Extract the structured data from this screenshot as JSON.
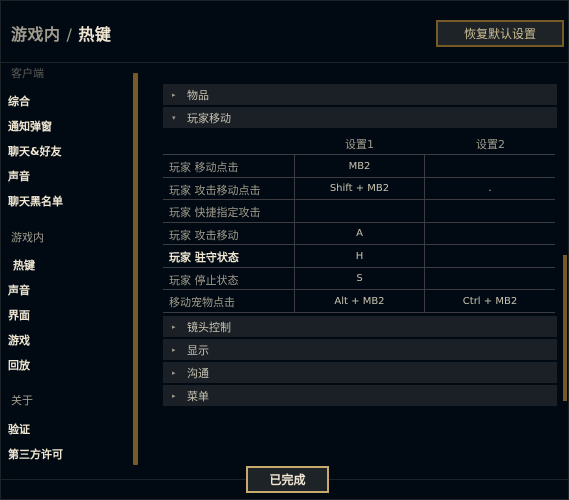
{
  "header": {
    "crumb_parent": "游戏内",
    "separator": "/",
    "crumb_current": "热键",
    "reset_label": "恢复默认设置"
  },
  "sidebar": {
    "group_client": "客户端",
    "client_items": [
      "综合",
      "通知弹窗",
      "聊天&好友",
      "声音",
      "聊天黑名单"
    ],
    "group_ingame": "游戏内",
    "ingame_items": [
      "热键",
      "声音",
      "界面",
      "游戏",
      "回放"
    ],
    "group_about": "关于",
    "about_items": [
      "验证",
      "第三方许可"
    ],
    "active_item": "热键"
  },
  "sections": {
    "items": "物品",
    "player_move": "玩家移动",
    "camera": "镜头控制",
    "display": "显示",
    "communication": "沟通",
    "menu": "菜单"
  },
  "table": {
    "col1": "设置1",
    "col2": "设置2",
    "rows": [
      {
        "name": "玩家 移动点击",
        "s1": "MB2",
        "s2": ""
      },
      {
        "name": "玩家 攻击移动点击",
        "s1": "Shift + MB2",
        "s2": "."
      },
      {
        "name": "玩家 快捷指定攻击",
        "s1": "",
        "s2": ""
      },
      {
        "name": "玩家 攻击移动",
        "s1": "A",
        "s2": ""
      },
      {
        "name": "玩家 驻守状态",
        "s1": "H",
        "s2": ""
      },
      {
        "name": "玩家 停止状态",
        "s1": "S",
        "s2": ""
      },
      {
        "name": "移动宠物点击",
        "s1": "Alt + MB2",
        "s2": "Ctrl + MB2"
      }
    ]
  },
  "footer": {
    "done_label": "已完成"
  }
}
